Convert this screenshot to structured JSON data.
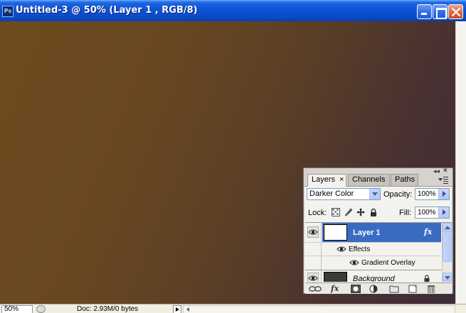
{
  "window": {
    "app_icon_text": "Ps",
    "title": "Untitled-3 @ 50% (Layer 1 , RGB/8)"
  },
  "colors": {
    "titlebar": "#0c52d6",
    "canvas_from": "#6e4a1f",
    "canvas_to": "#3d2b3a",
    "selected_layer": "#3a6bc3"
  },
  "status": {
    "zoom": "50%",
    "doc_info": "Doc: 2.93M/0 bytes"
  },
  "layers_panel": {
    "tabs": [
      {
        "label": "Layers",
        "active": true
      },
      {
        "label": "Channels",
        "active": false
      },
      {
        "label": "Paths",
        "active": false
      }
    ],
    "tab_close": "×",
    "collapse_glyph": "◂◂",
    "close_glyph": "×",
    "blend_mode": "Darker Color",
    "opacity_label": "Opacity:",
    "opacity_value": "100%",
    "lock_label": "Lock:",
    "fill_label": "Fill:",
    "fill_value": "100%",
    "fx_glyph": "fx",
    "layers": [
      {
        "name": "Layer 1",
        "selected": true,
        "has_effects": true
      },
      {
        "name": "Background",
        "selected": false,
        "locked": true
      }
    ],
    "effects_label": "Effects",
    "effect_name": "Gradient Overlay",
    "footer_icons": [
      "link-layers-icon",
      "fx-icon",
      "layer-mask-icon",
      "adjustment-layer-icon",
      "group-folder-icon",
      "new-layer-icon",
      "trash-icon"
    ]
  }
}
